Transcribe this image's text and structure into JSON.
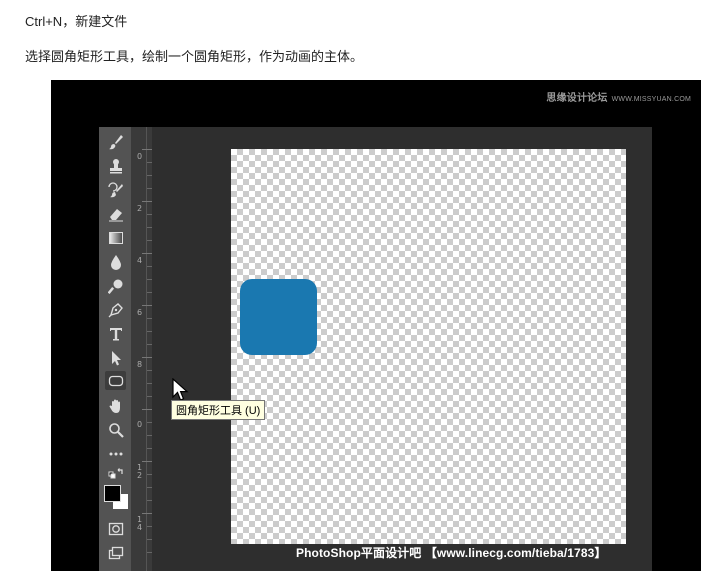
{
  "intro": {
    "line1": "Ctrl+N，新建文件",
    "line2": "选择圆角矩形工具，绘制一个圆角矩形，作为动画的主体。"
  },
  "screenshot": {
    "watermark_top": "思缘设计论坛",
    "watermark_top_url": "WWW.MISSYUAN.COM",
    "watermark_bottom": "PhotoShop平面设计吧 【www.linecg.com/tieba/1783】",
    "tooltip": "圆角矩形工具 (U)",
    "shape_color": "#1a78b0",
    "ruler_labels": [
      "0",
      "2",
      "4",
      "6",
      "8",
      "0",
      "1\n2",
      "1\n4"
    ],
    "tools": [
      "brush-icon",
      "stamp-icon",
      "history-brush-icon",
      "eraser-icon",
      "gradient-icon",
      "blur-drop-icon",
      "dodge-icon",
      "pen-icon",
      "type-icon",
      "path-selection-icon",
      "rounded-rectangle-icon",
      "hand-icon",
      "zoom-icon",
      "more-icon",
      "swap-colors-icon",
      "color-swatches",
      "quick-mask-icon",
      "screen-mode-icon"
    ]
  }
}
